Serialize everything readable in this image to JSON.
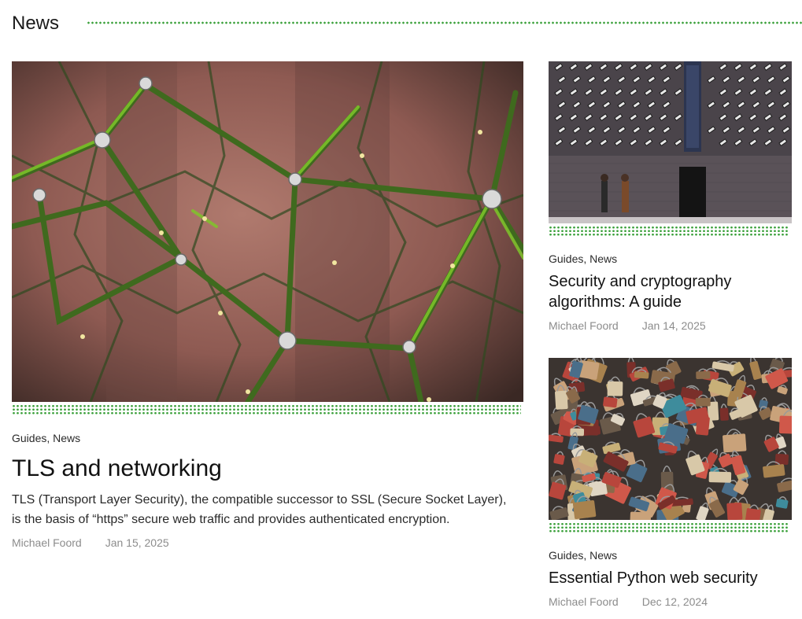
{
  "section": {
    "title": "News"
  },
  "posts": [
    {
      "categories": [
        "Guides",
        "News"
      ],
      "title": "TLS and networking",
      "excerpt": "TLS (Transport Layer Security), the compatible successor to SSL (Secure Socket Layer), is the basis of “https” secure web traffic and provides authenticated encryption.",
      "author": "Michael Foord",
      "date": "Jan 15, 2025"
    },
    {
      "categories": [
        "Guides",
        "News"
      ],
      "title": "Security and cryptography algorithms: A guide",
      "author": "Michael Foord",
      "date": "Jan 14, 2025"
    },
    {
      "categories": [
        "Guides",
        "News"
      ],
      "title": "Essential Python web security",
      "author": "Michael Foord",
      "date": "Dec 12, 2024"
    }
  ],
  "theme": {
    "accent": "#3aa03a"
  },
  "separator": ", "
}
